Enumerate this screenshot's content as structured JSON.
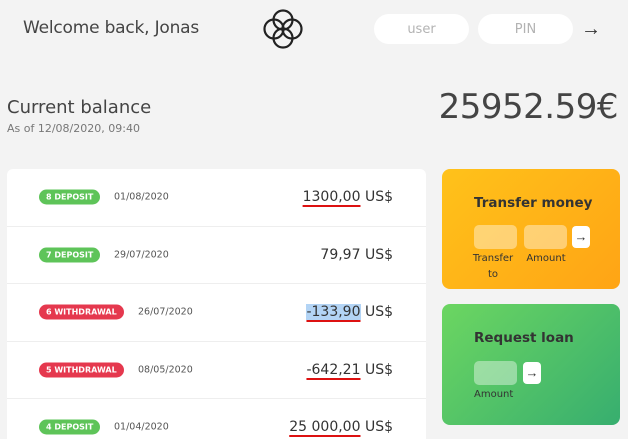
{
  "header": {
    "welcome": "Welcome back, Jonas",
    "user_placeholder": "user",
    "pin_placeholder": "PIN",
    "login_arrow": "→"
  },
  "balance": {
    "label": "Current balance",
    "date": "As of 12/08/2020, 09:40",
    "value": "25952.59€"
  },
  "movements": [
    {
      "type": "deposit",
      "badge": "8 DEPOSIT",
      "date": "01/08/2020",
      "value": "1300,00",
      "currency": "US$",
      "underlined": true,
      "selected": false
    },
    {
      "type": "deposit",
      "badge": "7 DEPOSIT",
      "date": "29/07/2020",
      "value": "79,97",
      "currency": "US$",
      "underlined": false,
      "selected": false
    },
    {
      "type": "withdrawal",
      "badge": "6 WITHDRAWAL",
      "date": "26/07/2020",
      "value": "-133,90",
      "currency": "US$",
      "underlined": true,
      "selected": true
    },
    {
      "type": "withdrawal",
      "badge": "5 WITHDRAWAL",
      "date": "08/05/2020",
      "value": "-642,21",
      "currency": "US$",
      "underlined": true,
      "selected": false
    },
    {
      "type": "deposit",
      "badge": "4 DEPOSIT",
      "date": "01/04/2020",
      "value": "25 000,00",
      "currency": "US$",
      "underlined": true,
      "selected": false
    }
  ],
  "transfer": {
    "title": "Transfer money",
    "label_to": "Transfer to",
    "label_amount": "Amount",
    "button": "→"
  },
  "loan": {
    "title": "Request loan",
    "label_amount": "Amount",
    "button": "→"
  },
  "colors": {
    "deposit": "#5ec459",
    "withdrawal": "#e5384e",
    "transfer_card": "#ffb01a",
    "loan_card": "#4cc068",
    "underline": "#dd1111",
    "selection": "#b3d4f5"
  },
  "icons": {
    "logo": "bankist-logo-icon",
    "login_arrow": "arrow-right-icon"
  }
}
